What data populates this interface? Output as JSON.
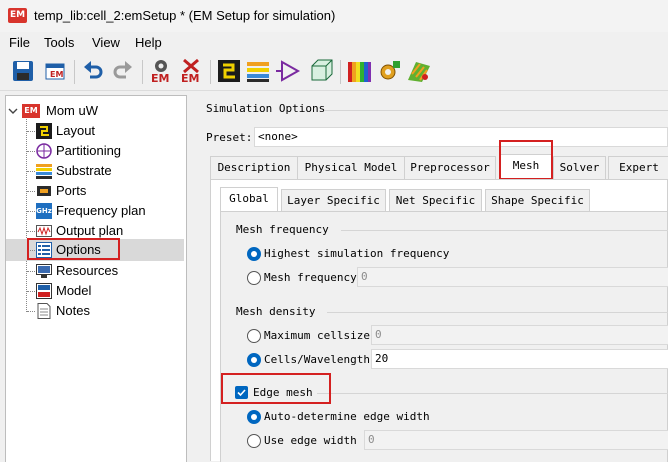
{
  "window": {
    "title": "temp_lib:cell_2:emSetup * (EM Setup for simulation)",
    "app_icon_text": "EM"
  },
  "menu": [
    "File",
    "Tools",
    "View",
    "Help"
  ],
  "toolbar": {
    "buttons": [
      "save-icon",
      "em-export-icon",
      "undo-icon",
      "redo-icon",
      "em-simulate-icon",
      "em-stop-icon",
      "layout-icon",
      "substrate-icon",
      "port-icon",
      "box-icon",
      "spectrum-icon",
      "gear-optimize-icon",
      "field-plot-icon"
    ],
    "em_label": "EM"
  },
  "tree": {
    "root": "Mom uW",
    "items": [
      "Layout",
      "Partitioning",
      "Substrate",
      "Ports",
      "Frequency plan",
      "Output plan",
      "Options",
      "Resources",
      "Model",
      "Notes"
    ],
    "selected": "Options",
    "ghz_icon_text": "GHz"
  },
  "right": {
    "section_title": "Simulation Options",
    "preset_label": "Preset:",
    "preset_value": "<none>",
    "tabs": [
      "Description",
      "Physical Model",
      "Preprocessor",
      "Mesh",
      "Solver",
      "Expert"
    ],
    "active_tab": "Mesh",
    "subtabs": [
      "Global",
      "Layer Specific",
      "Net Specific",
      "Shape Specific"
    ],
    "active_subtab": "Global",
    "mesh_frequency": {
      "group_title": "Mesh frequency",
      "option_highest": "Highest simulation frequency",
      "option_mesh_freq": "Mesh frequency",
      "mesh_freq_value": "0",
      "selected": "Highest simulation frequency"
    },
    "mesh_density": {
      "group_title": "Mesh density",
      "option_max_cellsize": "Maximum cellsize",
      "max_cellsize_value": "0",
      "option_cells_wavelength": "Cells/Wavelength",
      "cells_wavelength_value": "20",
      "selected": "Cells/Wavelength"
    },
    "edge_mesh": {
      "label": "Edge mesh",
      "checked": true,
      "option_auto": "Auto-determine edge width",
      "option_use": "Use edge width",
      "edge_width_value": "0",
      "selected": "Auto-determine edge width"
    }
  }
}
